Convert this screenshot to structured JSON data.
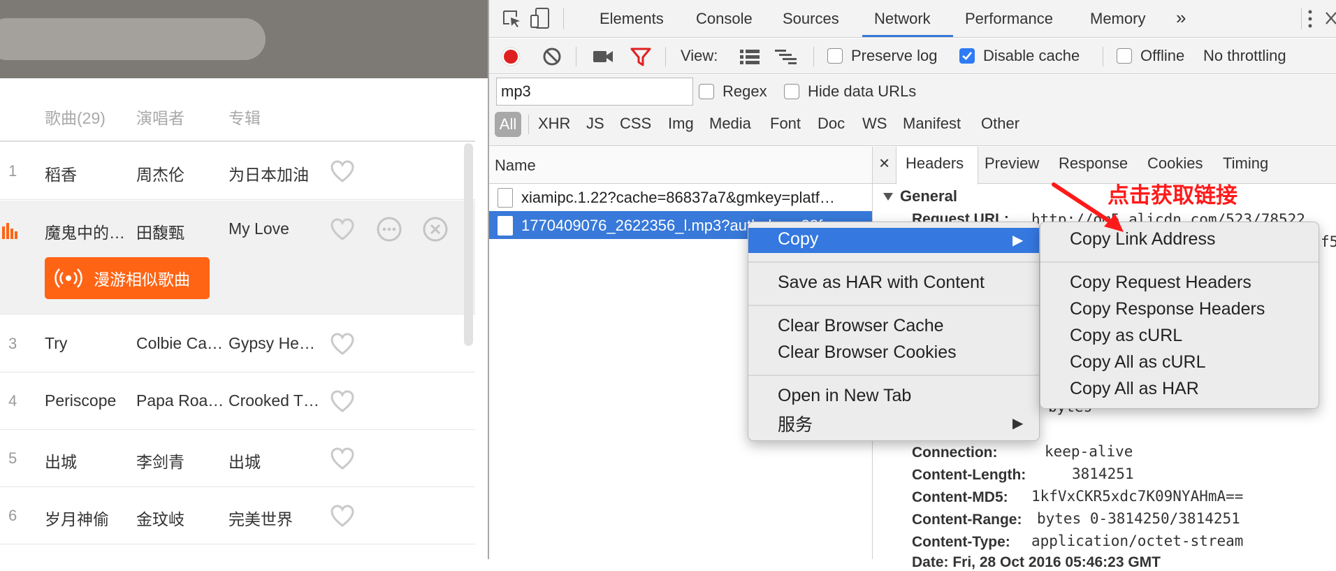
{
  "music": {
    "columns": [
      "歌曲(29)",
      "演唱者",
      "专辑"
    ],
    "rows": [
      {
        "num": "1",
        "song": "稻香",
        "artist": "周杰伦",
        "album": "为日本加油"
      },
      {
        "num": "",
        "song": "魔鬼中的…",
        "artist": "田馥甄",
        "album": "My Love"
      },
      {
        "num": "3",
        "song": "Try",
        "artist": "Colbie Ca…",
        "album": "Gypsy He…"
      },
      {
        "num": "4",
        "song": "Periscope",
        "artist": "Papa Roa…",
        "album": "Crooked T…"
      },
      {
        "num": "5",
        "song": "出城",
        "artist": "李剑青",
        "album": "出城"
      },
      {
        "num": "6",
        "song": "岁月神偷",
        "artist": "金玟岐",
        "album": "完美世界"
      }
    ],
    "roam_button": "漫游相似歌曲",
    "accent": "#ff6414"
  },
  "devtools": {
    "tabs": [
      "Elements",
      "Console",
      "Sources",
      "Network",
      "Performance",
      "Memory"
    ],
    "more_tabs": "»",
    "active_tab": "Network",
    "toolbar": {
      "view_label": "View:",
      "preserve_log": "Preserve log",
      "preserve_log_checked": false,
      "disable_cache": "Disable cache",
      "disable_cache_checked": true,
      "offline": "Offline",
      "throttling": "No throttling"
    },
    "filter": {
      "value": "mp3",
      "regex": "Regex",
      "hide_data_urls": "Hide data URLs",
      "types": [
        "All",
        "XHR",
        "JS",
        "CSS",
        "Img",
        "Media",
        "Font",
        "Doc",
        "WS",
        "Manifest",
        "Other"
      ]
    },
    "requests": {
      "column": "Name",
      "items": [
        "xiamipc.1.22?cache=86837a7&gmkey=platf…",
        "1770409076_2622356_l.mp3?auth_key=38f"
      ],
      "selected_index": 1
    },
    "details": {
      "close": "×",
      "tabs": [
        "Headers",
        "Preview",
        "Response",
        "Cookies",
        "Timing"
      ],
      "active_tab": "Headers",
      "general": "General",
      "request_url_label": "Request URL:",
      "request_url_value": "http://om5.alicdn.com/523/78522",
      "partial_right": "f5",
      "partial_value": "bytes",
      "headers": [
        {
          "k": "Connection:",
          "v": "keep-alive"
        },
        {
          "k": "Content-Length:",
          "v": "3814251"
        },
        {
          "k": "Content-MD5:",
          "v": "1kfVxCKR5xdc7K09NYAHmA=="
        },
        {
          "k": "Content-Range:",
          "v": "bytes 0-3814250/3814251"
        },
        {
          "k": "Content-Type:",
          "v": "application/octet-stream"
        }
      ],
      "partial_bottom": "Date: Fri, 28 Oct 2016 05:46:23 GMT"
    }
  },
  "context_menu": {
    "copy": "Copy",
    "save_har": "Save as HAR with Content",
    "clear_cache": "Clear Browser Cache",
    "clear_cookies": "Clear Browser Cookies",
    "open_new_tab": "Open in New Tab",
    "services": "服务"
  },
  "copy_submenu": {
    "copy_link": "Copy Link Address",
    "copy_req_headers": "Copy Request Headers",
    "copy_resp_headers": "Copy Response Headers",
    "copy_curl": "Copy as cURL",
    "copy_all_curl": "Copy All as cURL",
    "copy_all_har": "Copy All as HAR"
  },
  "annotation": {
    "text": "点击获取链接",
    "color": "#ff1a1a"
  },
  "colors": {
    "selection_blue": "#3879d9",
    "menu_highlight": "#3478e0",
    "record_red": "#e02020"
  }
}
